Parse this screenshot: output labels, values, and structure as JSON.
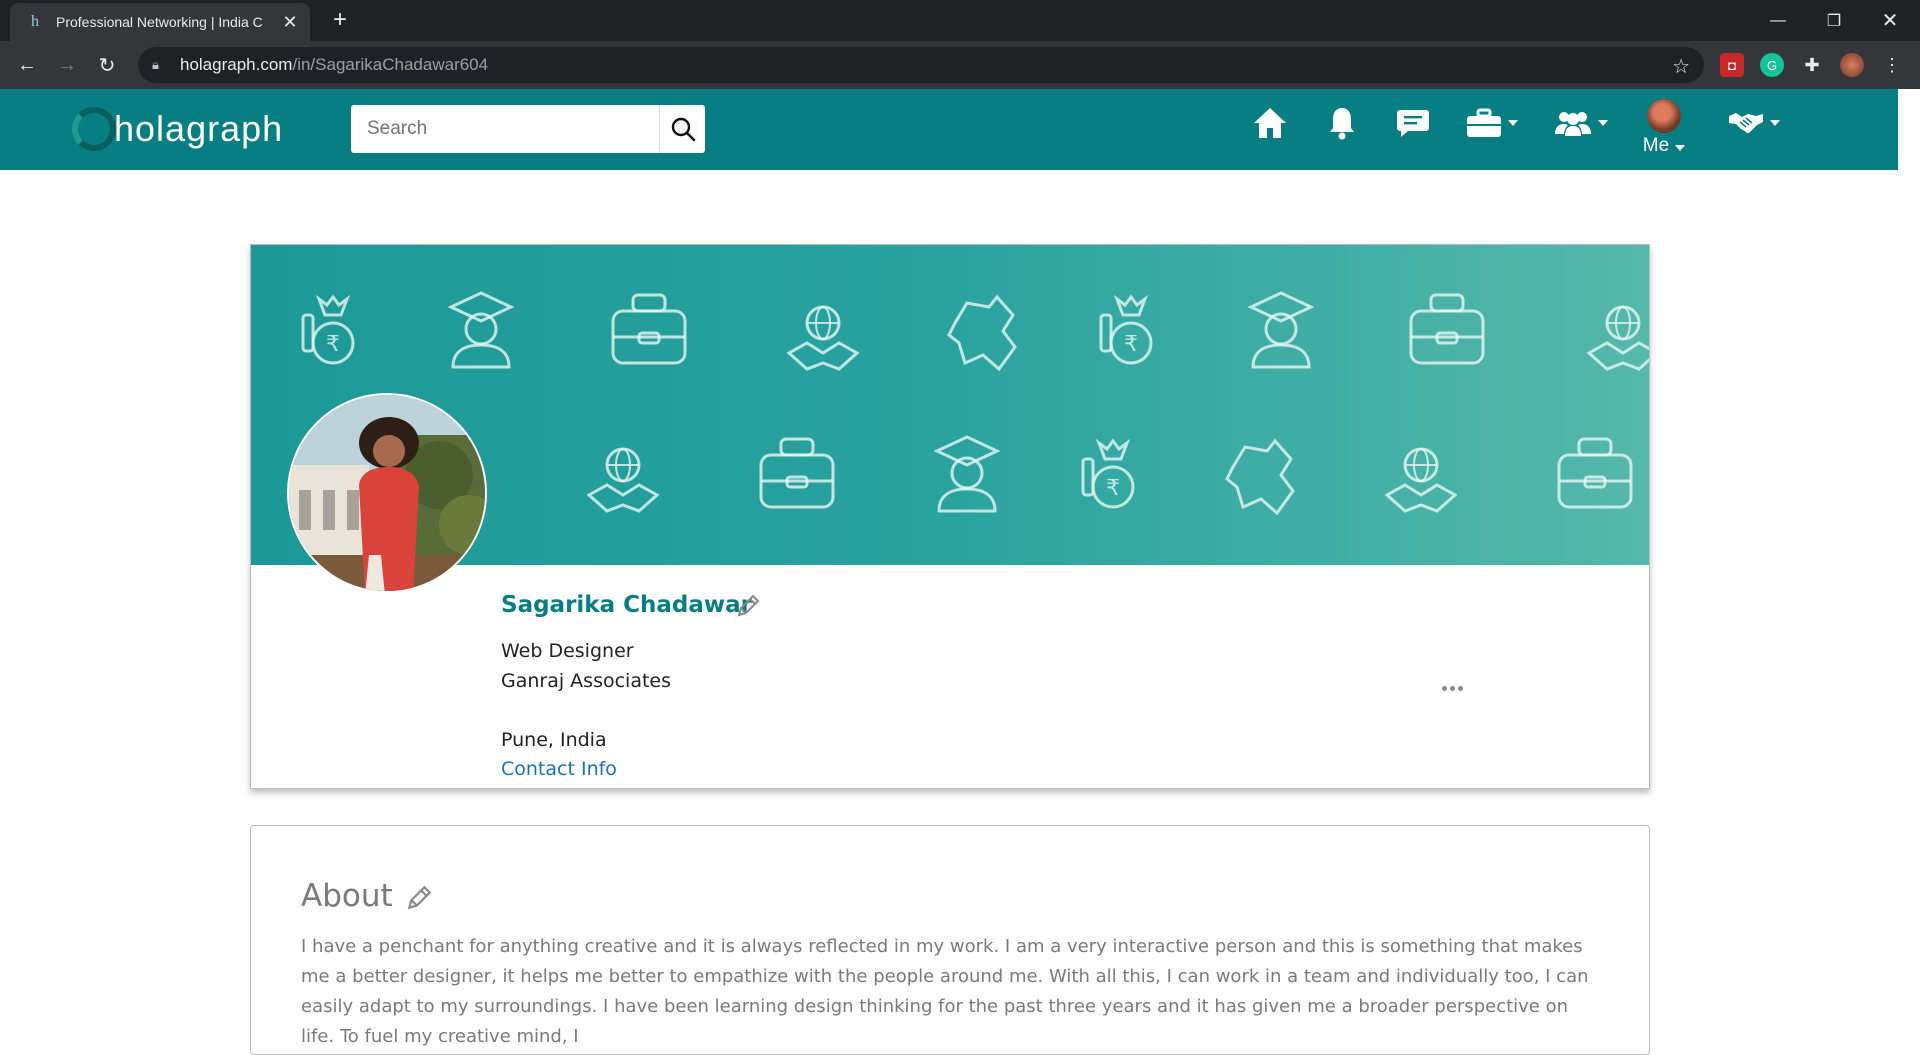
{
  "browser": {
    "tab_title": "Professional Networking | India C",
    "favicon_letter": "h",
    "url_host": "holagraph.com",
    "url_path": "/in/SagarikaChadawar604"
  },
  "header": {
    "logo_text": "holagraph",
    "search_placeholder": "Search",
    "me_label": "Me"
  },
  "profile": {
    "name": "Sagarika Chadawar",
    "headline": "Web Designer",
    "company": "Ganraj Associates",
    "location": "Pune, India",
    "contact_label": "Contact Info"
  },
  "about": {
    "title": "About",
    "text": "I have a penchant for anything creative and it is always reflected in my work. I am a very interactive person and this is something that makes me a better designer, it helps me better to empathize with the people around me. With all this, I can work in a team and individually too, I can easily adapt to my surroundings. I have been learning design thinking for the past three years and it has given me a broader perspective on life. To fuel my creative mind, I"
  },
  "colors": {
    "brand": "#077f82",
    "link": "#1a73b8"
  },
  "icons": [
    "home-icon",
    "bell-icon",
    "chat-icon",
    "briefcase-icon",
    "people-icon",
    "handshake-icon",
    "search-icon",
    "pencil-icon",
    "more-icon"
  ]
}
